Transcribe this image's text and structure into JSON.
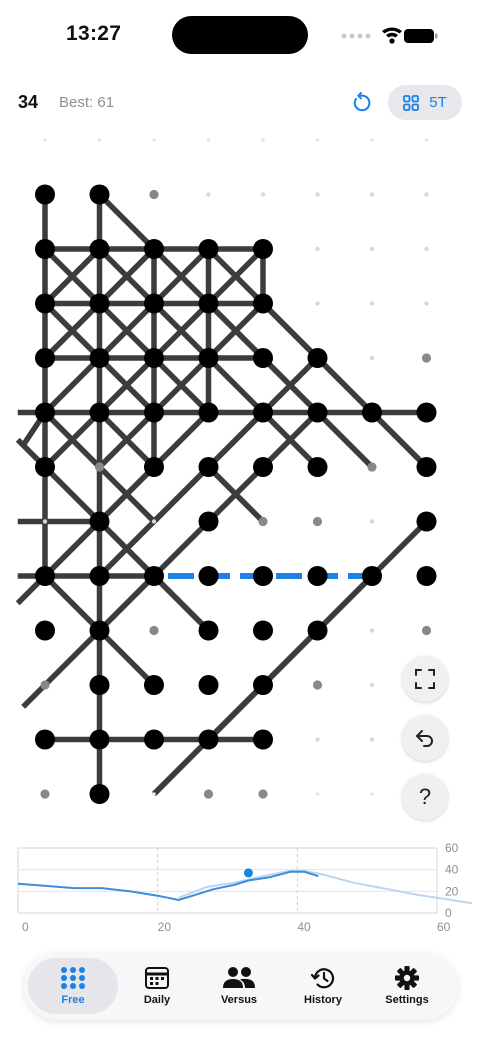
{
  "status": {
    "time": "13:27"
  },
  "header": {
    "score": "34",
    "best": "Best: 61",
    "mode_label": "5T"
  },
  "help_label": "?",
  "colors": {
    "accent": "#1a82e8",
    "line": "#3c3c3c",
    "dot": "#000000",
    "empty_dot": "#888888",
    "chart_line": "#3c8ddc",
    "chart_line_light": "#b9d6f2"
  },
  "chart_data": {
    "type": "line",
    "xlim": [
      0,
      60
    ],
    "ylim": [
      0,
      60
    ],
    "x_ticks": [
      "0",
      "20",
      "40",
      "60"
    ],
    "y_ticks": [
      "60",
      "40",
      "20",
      "0"
    ],
    "series": [
      {
        "values": [
          [
            0,
            27
          ],
          [
            4,
            25
          ],
          [
            8,
            23
          ],
          [
            12,
            23
          ],
          [
            16,
            20
          ],
          [
            20,
            16
          ],
          [
            23,
            12
          ],
          [
            25,
            16
          ],
          [
            28,
            22
          ],
          [
            31,
            26
          ],
          [
            33,
            30
          ],
          [
            36,
            33
          ],
          [
            39,
            38
          ],
          [
            41,
            38
          ],
          [
            43,
            34
          ]
        ]
      },
      {
        "values": [
          [
            23,
            14
          ],
          [
            27,
            24
          ],
          [
            31,
            28
          ],
          [
            35,
            34
          ],
          [
            39,
            39
          ],
          [
            41,
            39
          ],
          [
            44,
            35
          ],
          [
            48,
            28
          ],
          [
            53,
            22
          ],
          [
            57,
            17
          ],
          [
            61,
            13
          ],
          [
            65,
            9
          ]
        ]
      }
    ],
    "marker": [
      33,
      37
    ]
  },
  "tabs": [
    {
      "label": "Free"
    },
    {
      "label": "Daily"
    },
    {
      "label": "Versus"
    },
    {
      "label": "History"
    },
    {
      "label": "Settings"
    }
  ]
}
